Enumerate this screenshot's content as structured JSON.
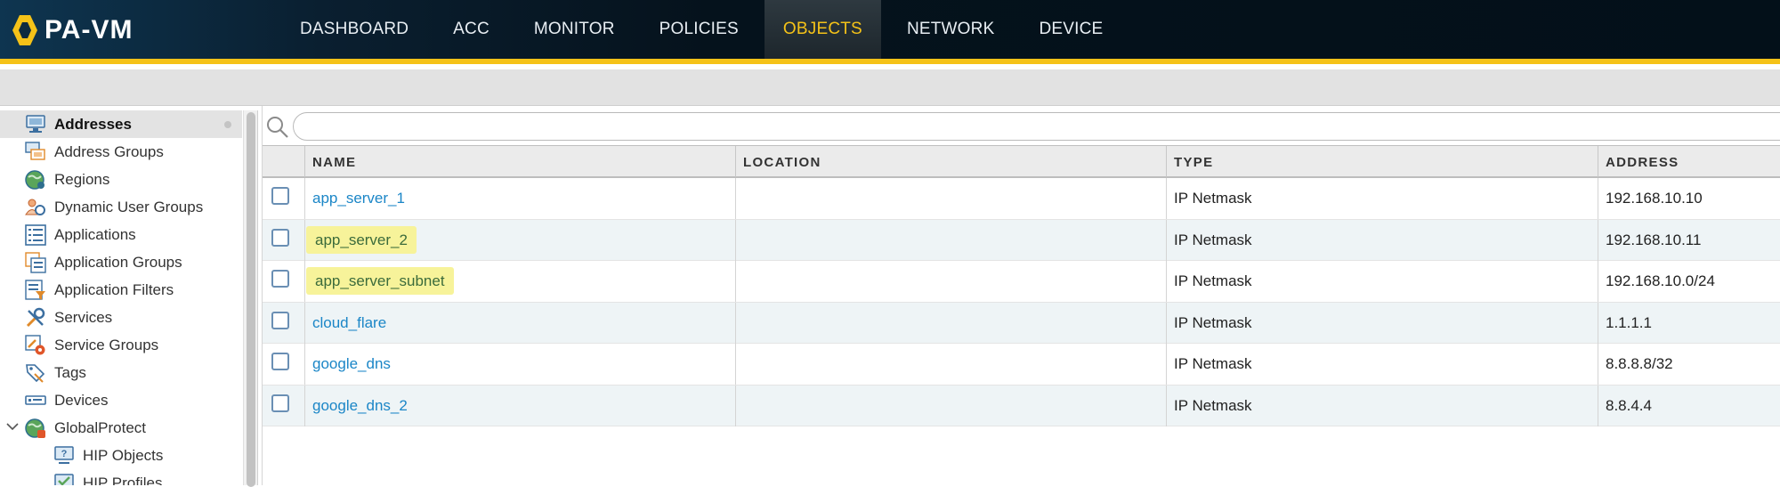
{
  "app": {
    "title": "PA-VM"
  },
  "nav": {
    "tabs": [
      {
        "label": "DASHBOARD",
        "active": false
      },
      {
        "label": "ACC",
        "active": false
      },
      {
        "label": "MONITOR",
        "active": false
      },
      {
        "label": "POLICIES",
        "active": false
      },
      {
        "label": "OBJECTS",
        "active": true
      },
      {
        "label": "NETWORK",
        "active": false
      },
      {
        "label": "DEVICE",
        "active": false
      }
    ]
  },
  "sidebar": {
    "items": [
      {
        "label": "Addresses",
        "icon": "addresses-icon",
        "active": true
      },
      {
        "label": "Address Groups",
        "icon": "address-groups-icon"
      },
      {
        "label": "Regions",
        "icon": "regions-globe-icon"
      },
      {
        "label": "Dynamic User Groups",
        "icon": "dynamic-user-groups-icon"
      },
      {
        "label": "Applications",
        "icon": "applications-icon"
      },
      {
        "label": "Application Groups",
        "icon": "application-groups-icon"
      },
      {
        "label": "Application Filters",
        "icon": "application-filters-icon"
      },
      {
        "label": "Services",
        "icon": "services-tools-icon"
      },
      {
        "label": "Service Groups",
        "icon": "service-groups-icon"
      },
      {
        "label": "Tags",
        "icon": "tags-icon"
      },
      {
        "label": "Devices",
        "icon": "devices-icon"
      },
      {
        "label": "GlobalProtect",
        "icon": "globalprotect-icon",
        "expanded": true
      },
      {
        "label": "HIP Objects",
        "icon": "hip-objects-icon",
        "sub": true
      },
      {
        "label": "HIP Profiles",
        "icon": "hip-profiles-icon",
        "sub": true
      }
    ]
  },
  "search": {
    "placeholder": "",
    "value": ""
  },
  "table": {
    "columns": [
      "NAME",
      "LOCATION",
      "TYPE",
      "ADDRESS"
    ],
    "rows": [
      {
        "name": "app_server_1",
        "location": "",
        "type": "IP Netmask",
        "address": "192.168.10.10",
        "highlighted": false
      },
      {
        "name": "app_server_2",
        "location": "",
        "type": "IP Netmask",
        "address": "192.168.10.11",
        "highlighted": true
      },
      {
        "name": "app_server_subnet",
        "location": "",
        "type": "IP Netmask",
        "address": "192.168.10.0/24",
        "highlighted": true
      },
      {
        "name": "cloud_flare",
        "location": "",
        "type": "IP Netmask",
        "address": "1.1.1.1",
        "highlighted": false
      },
      {
        "name": "google_dns",
        "location": "",
        "type": "IP Netmask",
        "address": "8.8.8.8/32",
        "highlighted": false
      },
      {
        "name": "google_dns_2",
        "location": "",
        "type": "IP Netmask",
        "address": "8.8.4.4",
        "highlighted": false
      }
    ]
  },
  "colors": {
    "accent": "#f5c218",
    "link": "#1b86c7",
    "highlight": "#f7f39a",
    "header_dark": "#05121c"
  }
}
